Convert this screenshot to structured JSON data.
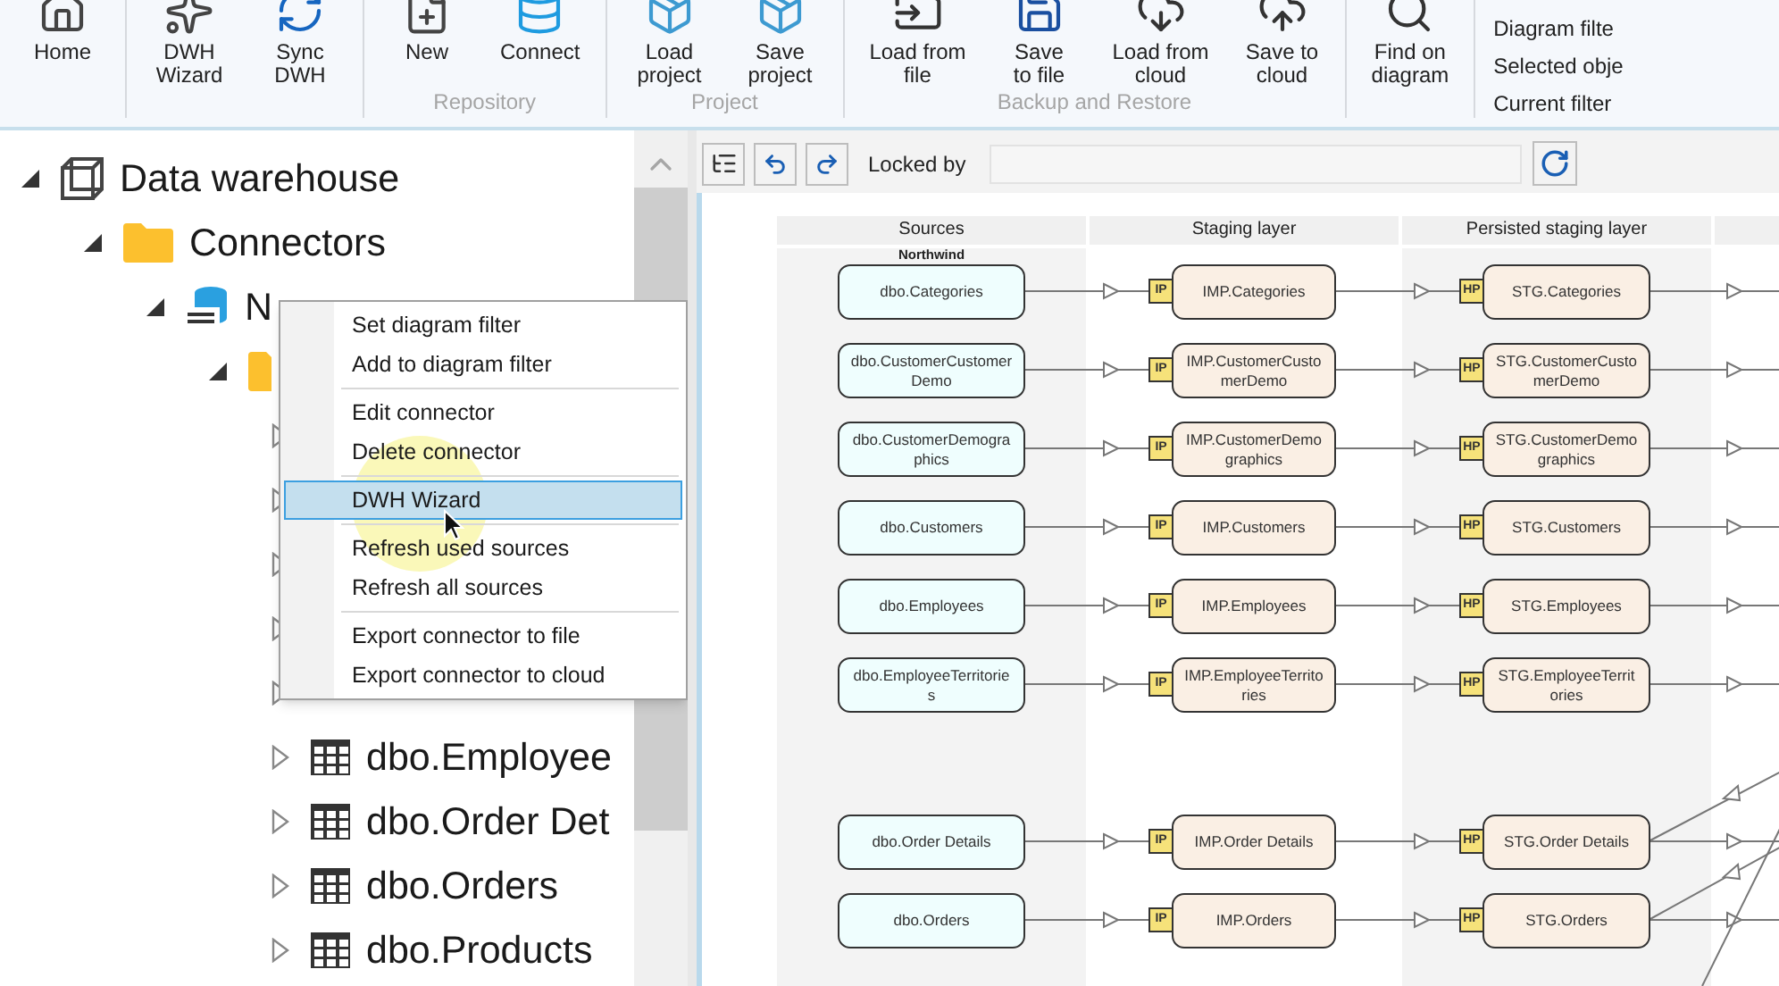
{
  "ribbon": {
    "groups": [
      {
        "buttons": [
          {
            "label": "Home"
          }
        ]
      },
      {
        "buttons": [
          {
            "label": "DWH\nWizard"
          },
          {
            "label": "Sync\nDWH"
          }
        ]
      },
      {
        "label": "Repository",
        "buttons": [
          {
            "label": "New"
          },
          {
            "label": "Connect"
          }
        ]
      },
      {
        "label": "Project",
        "buttons": [
          {
            "label": "Load\nproject"
          },
          {
            "label": "Save\nproject"
          }
        ]
      },
      {
        "label": "Backup and Restore",
        "buttons": [
          {
            "label": "Load from\nfile"
          },
          {
            "label": "Save\nto file"
          },
          {
            "label": "Load from\ncloud"
          },
          {
            "label": "Save to\ncloud"
          }
        ]
      },
      {
        "buttons": [
          {
            "label": "Find on\ndiagram"
          }
        ]
      }
    ],
    "side_commands": [
      "Diagram filte",
      "Selected obje",
      "Current filter"
    ]
  },
  "tree": {
    "label": "Data warehouse",
    "kind": "warehouse",
    "expanded": true,
    "children": [
      {
        "label": "Connectors",
        "kind": "folder",
        "expanded": true,
        "children": [
          {
            "label": "N",
            "kind": "sql",
            "expanded": true,
            "children": [
              {
                "kind": "folder",
                "expanded": true,
                "children": [
                  {
                    "kind": "table",
                    "expanded": false
                  },
                  {
                    "kind": "table",
                    "expanded": false
                  },
                  {
                    "kind": "table",
                    "expanded": false
                  },
                  {
                    "kind": "table",
                    "expanded": false
                  },
                  {
                    "kind": "table",
                    "expanded": false
                  },
                  {
                    "kind": "table",
                    "label": "dbo.Employee",
                    "expanded": false
                  },
                  {
                    "kind": "table",
                    "label": "dbo.Order Det",
                    "expanded": false
                  },
                  {
                    "kind": "table",
                    "label": "dbo.Orders",
                    "expanded": false
                  },
                  {
                    "kind": "table",
                    "label": "dbo.Products",
                    "expanded": false
                  }
                ]
              }
            ]
          }
        ]
      }
    ]
  },
  "context_menu": [
    {
      "kind": "item",
      "label": "Set diagram filter",
      "selected": false
    },
    {
      "kind": "item",
      "label": "Add to diagram filter",
      "selected": false
    },
    {
      "kind": "separator"
    },
    {
      "kind": "item",
      "label": "Edit connector",
      "selected": false
    },
    {
      "kind": "item",
      "label": "Delete connector",
      "selected": false
    },
    {
      "kind": "separator"
    },
    {
      "kind": "item",
      "label": "DWH Wizard",
      "selected": true
    },
    {
      "kind": "separator"
    },
    {
      "kind": "item",
      "label": "Refresh used sources",
      "selected": false
    },
    {
      "kind": "item",
      "label": "Refresh all sources",
      "selected": false
    },
    {
      "kind": "separator"
    },
    {
      "kind": "item",
      "label": "Export connector to file",
      "selected": false
    },
    {
      "kind": "item",
      "label": "Export connector to cloud",
      "selected": false
    }
  ],
  "diagram_toolbar": {
    "locked_by_label": "Locked by"
  },
  "diagram": {
    "columns": [
      "Sources",
      "Staging layer",
      "Persisted staging layer"
    ],
    "source_group": "Northwind",
    "rows": [
      {
        "kind": "node",
        "source": "dbo.Categories",
        "staging": {
          "badge": "IP",
          "label": "IMP.Categories"
        },
        "persisted": {
          "badge": "HP",
          "label": "STG.Categories"
        }
      },
      {
        "kind": "node",
        "source": "dbo.CustomerCustomerDemo",
        "staging": {
          "badge": "IP",
          "label": "IMP.CustomerCustomerDemo"
        },
        "persisted": {
          "badge": "HP",
          "label": "STG.CustomerCustomerDemo"
        }
      },
      {
        "kind": "node",
        "source": "dbo.CustomerDemographics",
        "staging": {
          "badge": "IP",
          "label": "IMP.CustomerDemographics"
        },
        "persisted": {
          "badge": "HP",
          "label": "STG.CustomerDemographics"
        }
      },
      {
        "kind": "node",
        "source": "dbo.Customers",
        "staging": {
          "badge": "IP",
          "label": "IMP.Customers"
        },
        "persisted": {
          "badge": "HP",
          "label": "STG.Customers"
        }
      },
      {
        "kind": "node",
        "source": "dbo.Employees",
        "staging": {
          "badge": "IP",
          "label": "IMP.Employees"
        },
        "persisted": {
          "badge": "HP",
          "label": "STG.Employees"
        }
      },
      {
        "kind": "node",
        "source": "dbo.EmployeeTerritories",
        "staging": {
          "badge": "IP",
          "label": "IMP.EmployeeTerritories"
        },
        "persisted": {
          "badge": "HP",
          "label": "STG.EmployeeTerritories"
        }
      },
      {
        "kind": "empty"
      },
      {
        "kind": "node",
        "source": "dbo.Order Details",
        "staging": {
          "badge": "IP",
          "label": "IMP.Order Details"
        },
        "persisted": {
          "badge": "HP",
          "label": "STG.Order Details"
        }
      },
      {
        "kind": "node",
        "source": "dbo.Orders",
        "staging": {
          "badge": "IP",
          "label": "IMP.Orders"
        },
        "persisted": {
          "badge": "HP",
          "label": "STG.Orders"
        }
      }
    ]
  }
}
